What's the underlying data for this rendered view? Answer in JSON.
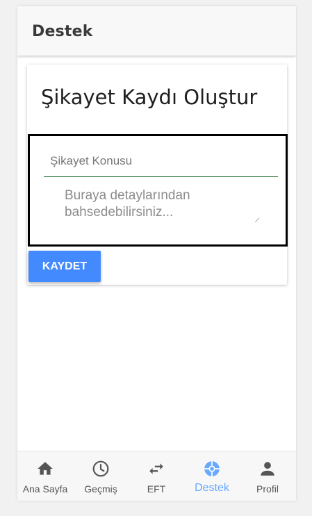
{
  "appbar": {
    "title": "Destek"
  },
  "card": {
    "title": "Şikayet Kaydı Oluştur",
    "subject_placeholder": "Şikayet Konusu",
    "subject_value": "",
    "details_placeholder": "Buraya detaylarından bahsedebilirsiniz...",
    "details_value": "",
    "save_label": "KAYDET"
  },
  "bottom_nav": {
    "items": [
      {
        "label": "Ana Sayfa",
        "icon": "home-icon",
        "active": false
      },
      {
        "label": "Geçmiş",
        "icon": "clock-icon",
        "active": false
      },
      {
        "label": "EFT",
        "icon": "swap-arrows-icon",
        "active": false
      },
      {
        "label": "Destek",
        "icon": "lifebuoy-icon",
        "active": true
      },
      {
        "label": "Profil",
        "icon": "person-icon",
        "active": false
      }
    ]
  },
  "colors": {
    "accent": "#448aff",
    "active_nav": "#69a8ff",
    "inactive_nav": "#555555",
    "input_underline": "#1b6b2e"
  }
}
